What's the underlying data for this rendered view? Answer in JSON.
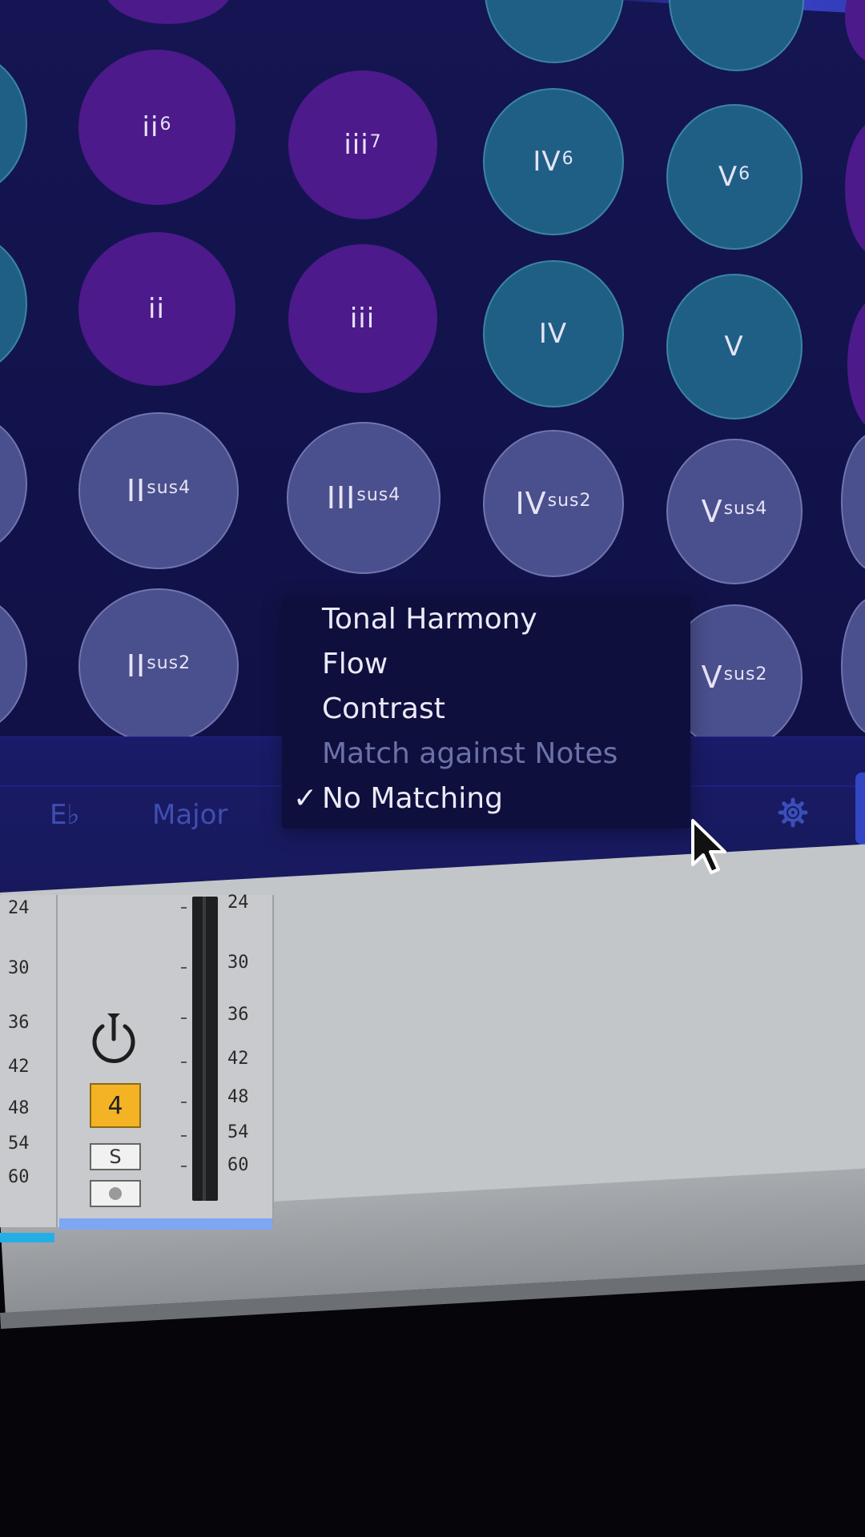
{
  "pads": [
    {
      "id": "ii6",
      "base": "ii",
      "sup": "6",
      "kind": "minor"
    },
    {
      "id": "iii7",
      "base": "iii",
      "sup": "7",
      "kind": "minor"
    },
    {
      "id": "IV6",
      "base": "IV",
      "sup": "6",
      "kind": "major"
    },
    {
      "id": "V6",
      "base": "V",
      "sup": "6",
      "kind": "major"
    },
    {
      "id": "ii",
      "base": "ii",
      "sup": "",
      "kind": "minor"
    },
    {
      "id": "iii",
      "base": "iii",
      "sup": "",
      "kind": "minor"
    },
    {
      "id": "IV",
      "base": "IV",
      "sup": "",
      "kind": "major"
    },
    {
      "id": "V",
      "base": "V",
      "sup": "",
      "kind": "major"
    },
    {
      "id": "IIsus4",
      "base": "II",
      "sup": "sus4",
      "kind": "sus"
    },
    {
      "id": "IIIsus4",
      "base": "III",
      "sup": "sus4",
      "kind": "sus"
    },
    {
      "id": "IVsus2",
      "base": "IV",
      "sup": "sus2",
      "kind": "sus"
    },
    {
      "id": "Vsus4",
      "base": "V",
      "sup": "sus4",
      "kind": "sus"
    },
    {
      "id": "IIsus2",
      "base": "II",
      "sup": "sus2",
      "kind": "sus"
    },
    {
      "id": "Vsus2",
      "base": "V",
      "sup": "sus2",
      "kind": "sus"
    }
  ],
  "key_bar": {
    "root": "E♭",
    "scale": "Major"
  },
  "menu": {
    "items": [
      {
        "label": "Tonal Harmony",
        "enabled": true
      },
      {
        "label": "Flow",
        "enabled": true
      },
      {
        "label": "Contrast",
        "enabled": true
      },
      {
        "label": "Match against Notes",
        "enabled": false
      },
      {
        "label": "No Matching",
        "enabled": true,
        "checked": true
      }
    ],
    "checkmark": "✓"
  },
  "mixer": {
    "left_scale": [
      "24",
      "30",
      "36",
      "42",
      "48",
      "54",
      "60"
    ],
    "right_scale": [
      "24",
      "30",
      "36",
      "42",
      "48",
      "54",
      "60"
    ],
    "track_number": "4",
    "solo_label": "S"
  },
  "colors": {
    "minor_pad": "#4c1a8a",
    "major_pad": "#1f5f86",
    "sus_pad": "#4a4f8d",
    "track_number_bg": "#f3b324"
  },
  "icons": {
    "gear": "gear-icon",
    "power": "power-icon",
    "cursor": "mouse-pointer-icon"
  }
}
